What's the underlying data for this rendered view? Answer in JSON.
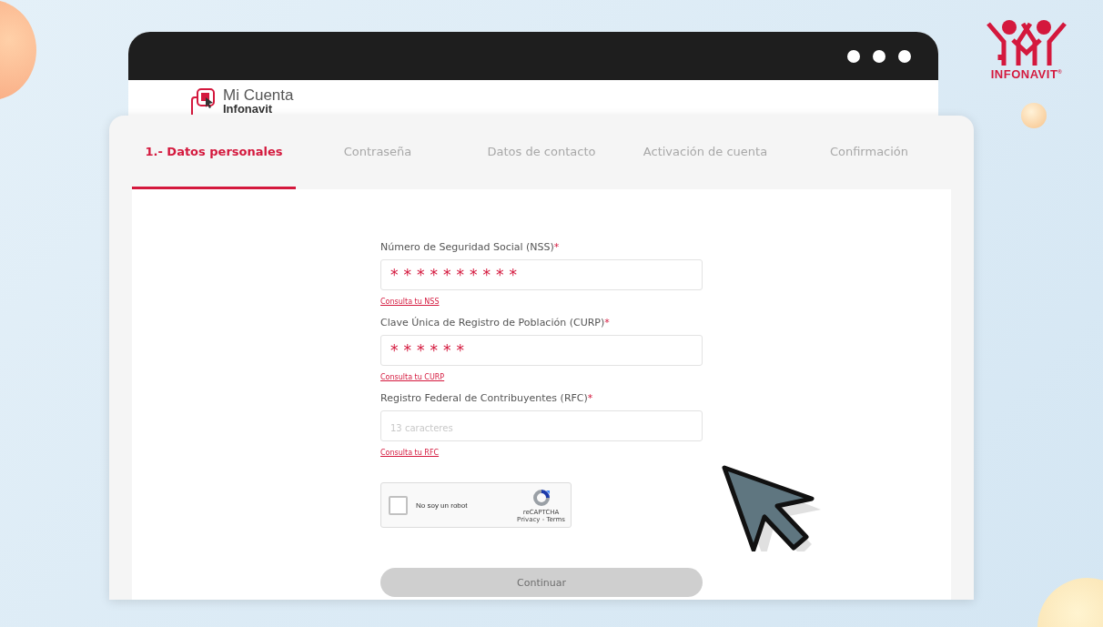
{
  "back_window": {
    "logo_line1": "Mi Cuenta",
    "logo_line2": "Infonavit"
  },
  "brand": {
    "name": "INFONAVIT",
    "mark": "®"
  },
  "steps": [
    {
      "label": "1.- Datos personales",
      "selected": true
    },
    {
      "label": "Contraseña",
      "selected": false
    },
    {
      "label": "Datos de contacto",
      "selected": false
    },
    {
      "label": "Activación de cuenta",
      "selected": false
    },
    {
      "label": "Confirmación",
      "selected": false
    }
  ],
  "fields": [
    {
      "label": "Número de Seguridad Social (NSS)",
      "required_mark": "*",
      "value": "**********",
      "link": "Consulta tu NSS"
    },
    {
      "label": "Clave Única de Registro de Población (CURP)",
      "required_mark": "*",
      "value": "******",
      "link": "Consulta tu CURP"
    },
    {
      "label": "Registro Federal de Contribuyentes (RFC)",
      "required_mark": "*",
      "placeholder": "13 caracteres",
      "link": "Consulta tu RFC"
    }
  ],
  "captcha": {
    "label": "No soy un robot",
    "checked": false,
    "brand": "reCAPTCHA",
    "terms": "Privacy - Terms"
  },
  "continue_button": {
    "label": "Continuar",
    "disabled": true
  }
}
